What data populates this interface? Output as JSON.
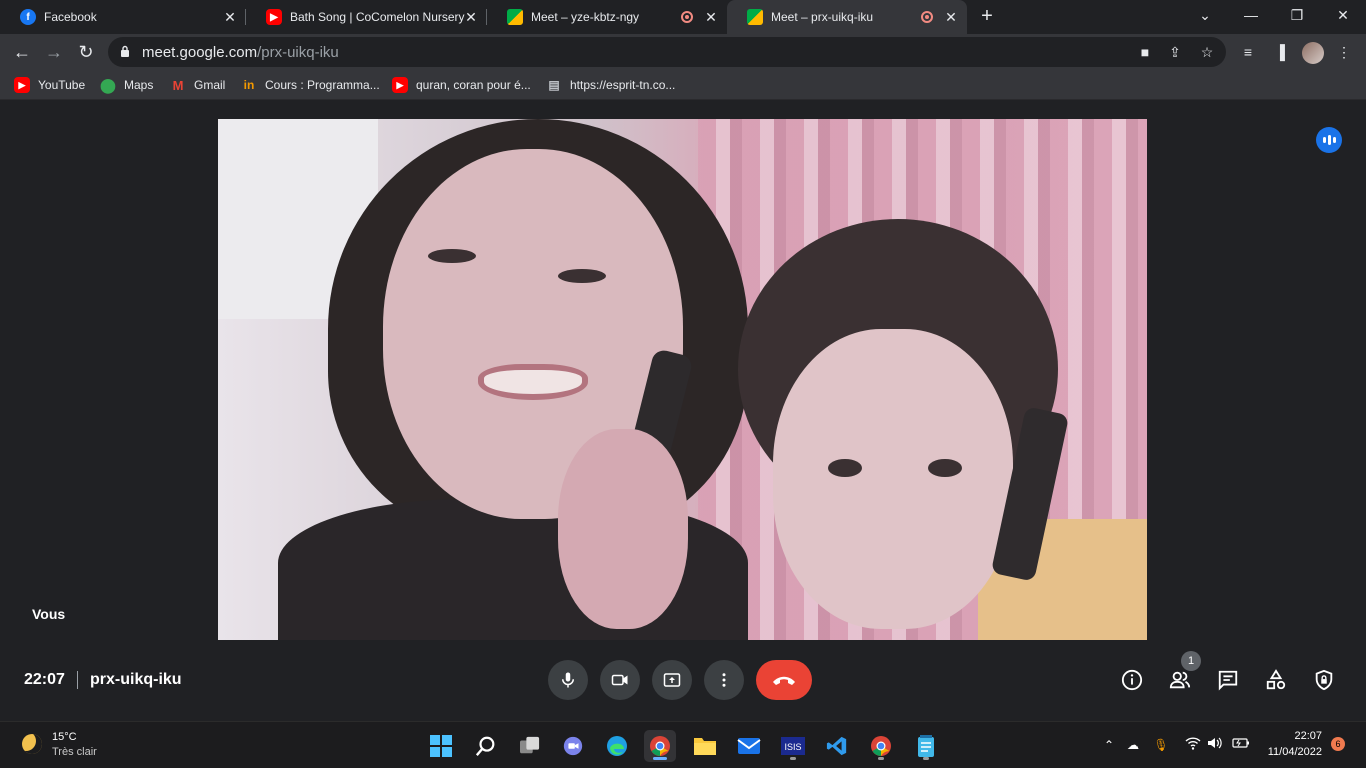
{
  "browser": {
    "tabs": [
      {
        "label": "Facebook",
        "icon": "facebook-icon"
      },
      {
        "label": "Bath Song | CoComelon Nursery",
        "icon": "youtube-icon"
      },
      {
        "label": "Meet – yze-kbtz-ngy",
        "icon": "meet-icon",
        "recording": true
      },
      {
        "label": "Meet – prx-uikq-iku",
        "icon": "meet-icon",
        "recording": true,
        "active": true
      }
    ],
    "url_host": "meet.google.com",
    "url_path": "/prx-uikq-iku",
    "bookmarks": [
      {
        "label": "YouTube",
        "icon": "youtube-icon"
      },
      {
        "label": "Maps",
        "icon": "maps-icon"
      },
      {
        "label": "Gmail",
        "icon": "gmail-icon"
      },
      {
        "label": "Cours : Programma...",
        "icon": "course-icon"
      },
      {
        "label": "quran, coran pour é...",
        "icon": "youtube-icon"
      },
      {
        "label": "https://esprit-tn.co...",
        "icon": "page-icon"
      }
    ]
  },
  "meet": {
    "self_label": "Vous",
    "time": "22:07",
    "meeting_code": "prx-uikq-iku",
    "participants_count": "1",
    "colors": {
      "hangup": "#ea4335",
      "speaking": "#1a73e8"
    }
  },
  "taskbar": {
    "temperature": "15°C",
    "condition": "Très clair",
    "clock": "22:07",
    "date": "11/04/2022",
    "notifications": "6"
  }
}
